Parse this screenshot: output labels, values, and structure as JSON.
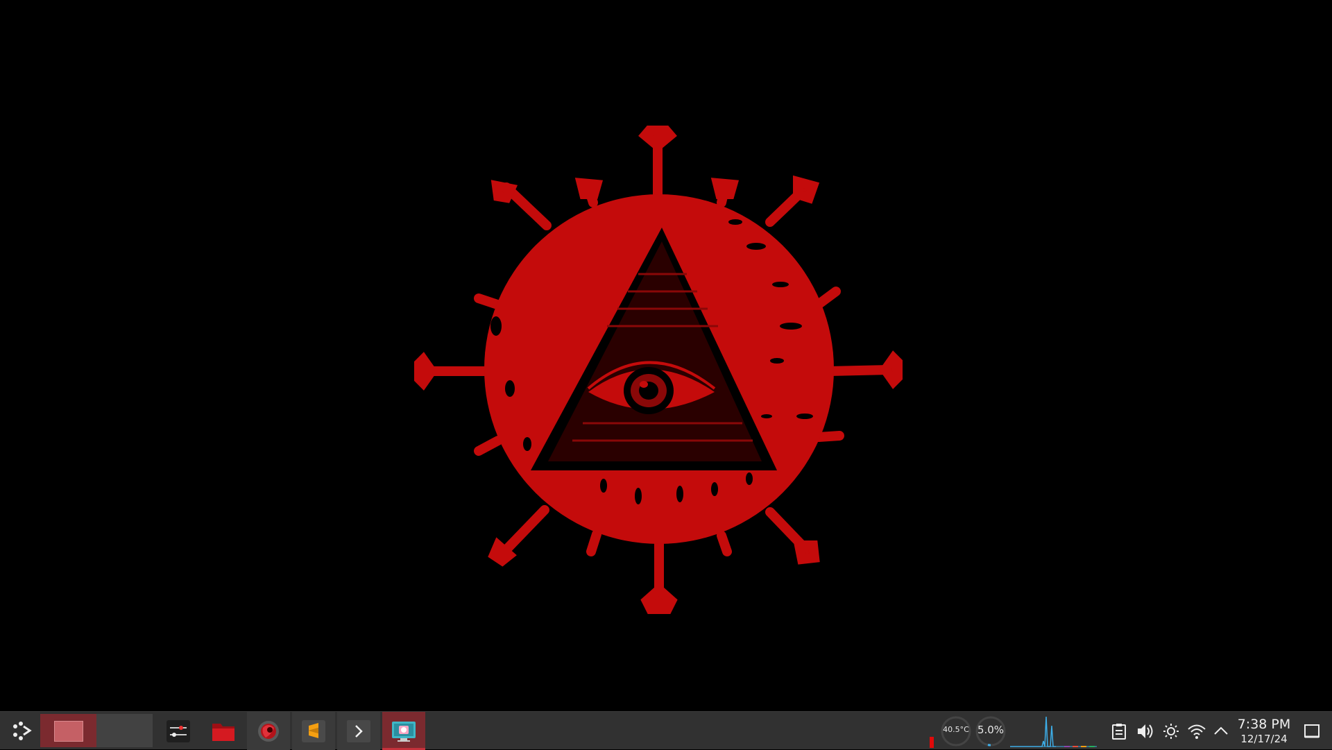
{
  "desktop": {
    "wallpaper_icon": "red-eye-of-providence-virus-icon",
    "background_color": "#000000",
    "accent_color": "#c40b0b"
  },
  "taskbar": {
    "background_color": "#313131",
    "active_color": "#7b2a2f",
    "launcher_icon": "application-launcher-icon",
    "pager": {
      "desktops": [
        {
          "name": "desktop-1",
          "active": true
        },
        {
          "name": "desktop-2",
          "active": false
        }
      ]
    },
    "tasks": [
      {
        "icon": "system-settings-icon",
        "state": "normal"
      },
      {
        "icon": "file-manager-folder-icon",
        "state": "normal"
      },
      {
        "icon": "web-browser-icon",
        "state": "open"
      },
      {
        "icon": "sublime-text-icon",
        "state": "open"
      },
      {
        "icon": "terminal-icon",
        "state": "open"
      },
      {
        "icon": "screenshot-tool-icon",
        "state": "active"
      }
    ],
    "monitors": {
      "temperature": "40.5°C",
      "cpu_usage": "5.0%"
    },
    "tray_icons": [
      "clipboard-icon",
      "volume-icon",
      "brightness-icon",
      "wifi-icon",
      "expand-tray-arrow-icon"
    ],
    "clock": {
      "time": "7:38 PM",
      "date": "12/17/24"
    },
    "show_desktop_icon": "show-desktop-icon"
  }
}
